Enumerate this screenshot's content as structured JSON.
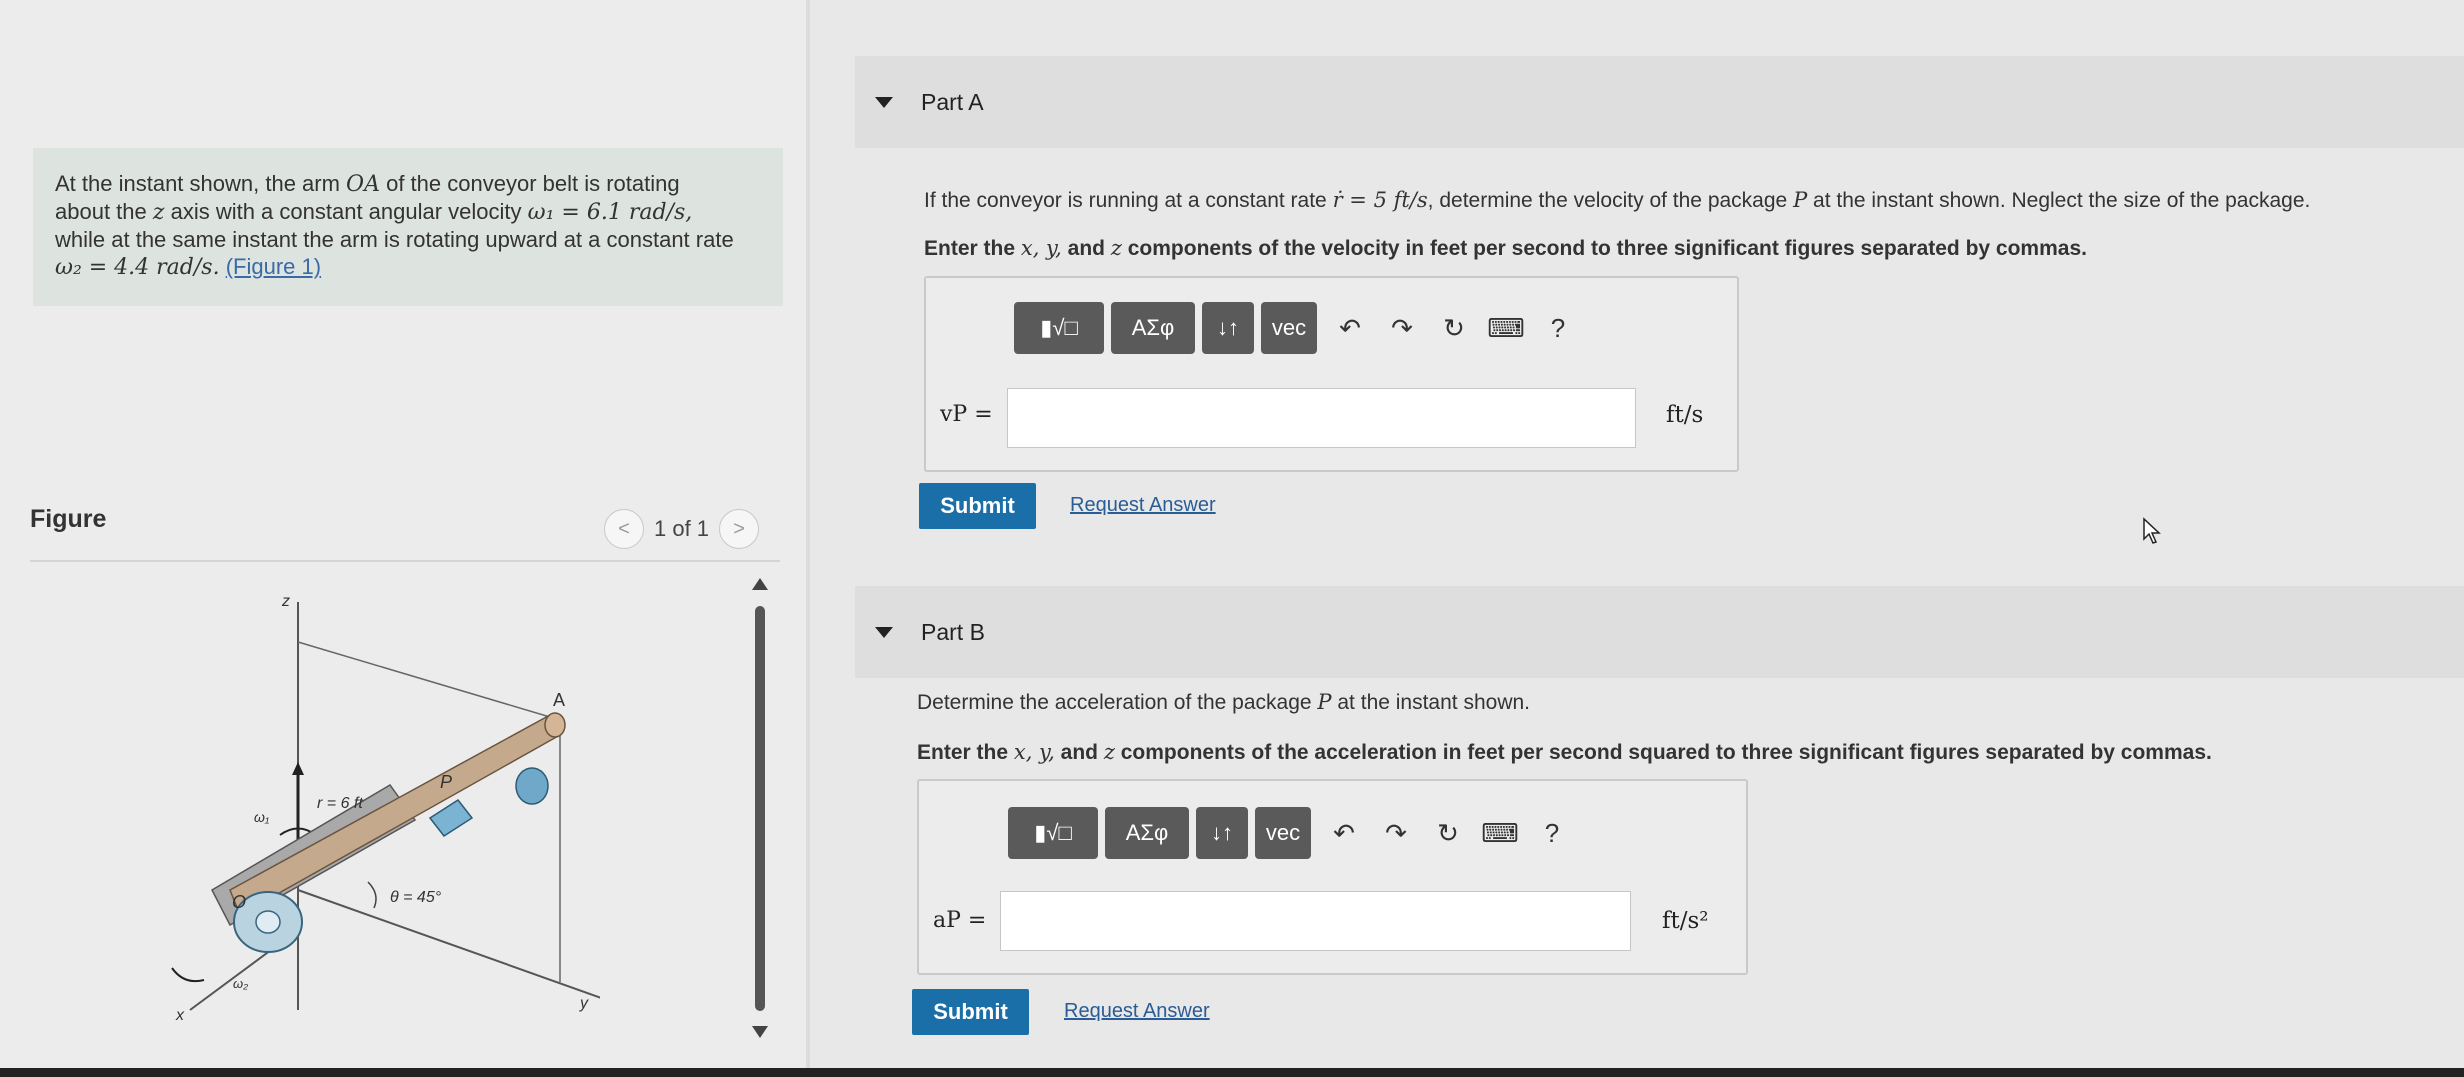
{
  "problem": {
    "line1": "At the instant shown, the arm ",
    "arm": "OA",
    "line1b": " of the conveyor belt is rotating",
    "line2a": "about the ",
    "zaxis": "z",
    "line2b": " axis with a constant angular velocity ",
    "omega1": "ω₁ = 6.1 rad/s,",
    "line3": "while at the same instant the arm is rotating upward at a constant rate",
    "omega2": "ω₂ = 4.4 rad/s.",
    "figure_link": "(Figure 1)"
  },
  "figure": {
    "title": "Figure",
    "pager": "1 of 1",
    "prev": "<",
    "next": ">",
    "labels": {
      "z": "z",
      "a": "A",
      "p": "P",
      "r": "r = 6 ft",
      "w1": "ω₁",
      "o": "O",
      "theta": "θ = 45°",
      "w2": "ω₂",
      "x": "x",
      "y": "y"
    }
  },
  "part_a": {
    "label": "Part A",
    "question_pre": "If the conveyor is running at a constant rate ",
    "rate": "ṙ = 5 ft/s",
    "question_mid": ", determine the velocity of the package ",
    "pkg": "P",
    "question_post": " at the instant shown. Neglect the size of the package.",
    "instruction_pre": "Enter the ",
    "xyz": "x, y,",
    "instruction_and": " and ",
    "zvar": "z",
    "instruction_post": " components of the velocity in feet per second to three significant figures separated by commas.",
    "var": "vP =",
    "unit": "ft/s",
    "submit": "Submit",
    "request": "Request Answer"
  },
  "part_b": {
    "label": "Part B",
    "question_pre": "Determine the acceleration of the package ",
    "pkg": "P",
    "question_post": " at the instant shown.",
    "instruction_pre": "Enter the ",
    "xyz": "x, y,",
    "instruction_and": " and ",
    "zvar": "z",
    "instruction_post": " components of the acceleration in feet per second squared to three significant figures separated by commas.",
    "var": "aP =",
    "unit": "ft/s²",
    "submit": "Submit",
    "request": "Request Answer"
  },
  "toolbar": {
    "templates": "▮√□",
    "symbols": "ΑΣφ",
    "arrows": "↓↑",
    "vec": "vec",
    "undo": "↶",
    "redo": "↷",
    "reset": "↻",
    "keyboard": "⌨",
    "help": "?"
  }
}
